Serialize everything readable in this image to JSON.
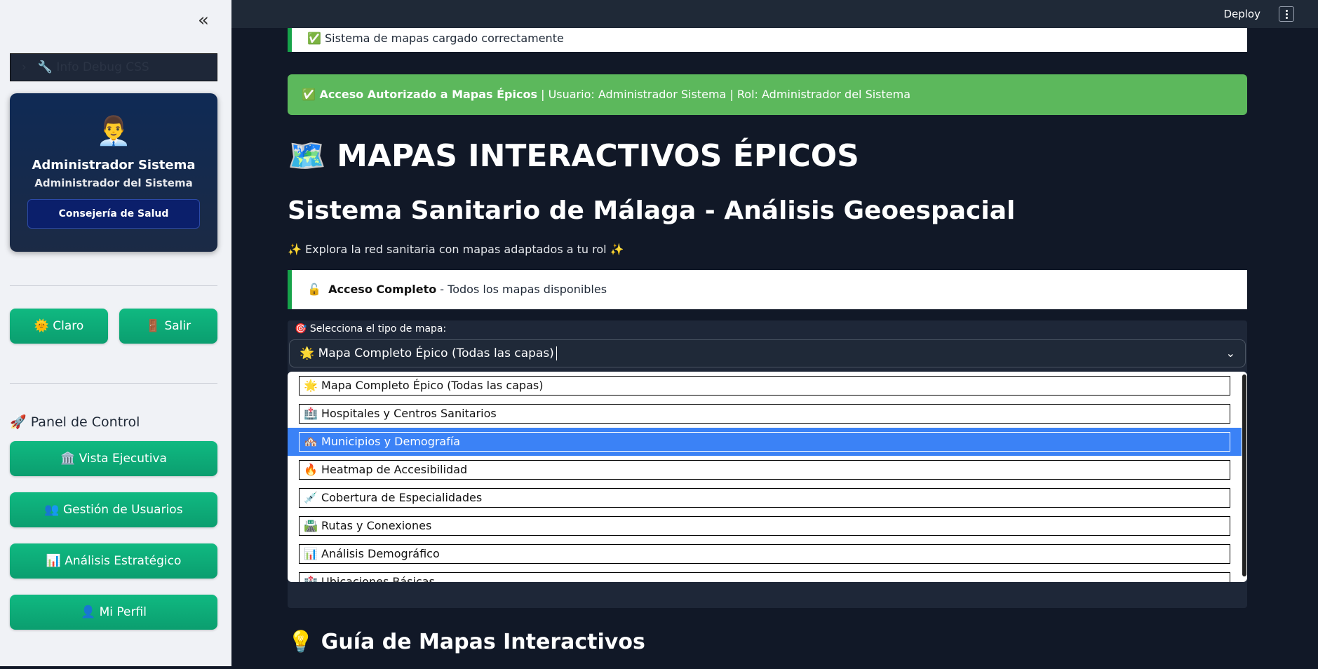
{
  "sidebar": {
    "collapse_icon": "«",
    "debug_label": "🔧 Info Debug CSS",
    "debug_chevron": "›",
    "profile": {
      "avatar": "👨‍💼",
      "name": "Administrador Sistema",
      "role": "Administrador del Sistema",
      "department": "Consejería de Salud"
    },
    "theme_button": "🌞 Claro",
    "logout_button": "🚪 Salir",
    "panel_title": "🚀 Panel de Control",
    "nav": [
      {
        "label": "🏛️ Vista Ejecutiva"
      },
      {
        "label": "👥 Gestión de Usuarios"
      },
      {
        "label": "📊 Análisis Estratégico"
      },
      {
        "label": "👤 Mi Perfil"
      }
    ]
  },
  "header": {
    "deploy": "Deploy",
    "menu_icon": "kebab-menu-icon"
  },
  "main": {
    "top_notice": "✅ Sistema de mapas cargado correctamente",
    "access_alert": {
      "bold": "✅ Acceso Autorizado a Mapas Épicos",
      "rest": " | Usuario: Administrador Sistema | Rol: Administrador del Sistema"
    },
    "title": "🗺️ MAPAS INTERACTIVOS ÉPICOS",
    "subtitle_title": "Sistema Sanitario de Málaga - Análisis Geoespacial",
    "tagline": "✨ Explora la red sanitaria con mapas adaptados a tu rol ✨",
    "access_box": {
      "icon": "🔓",
      "bold": "Acceso Completo",
      "rest": " - Todos los mapas disponibles"
    },
    "select": {
      "label": "🎯 Selecciona el tipo de mapa:",
      "value": "🌟 Mapa Completo Épico (Todas las capas)",
      "caret": "⌄",
      "options": [
        "🌟 Mapa Completo Épico (Todas las capas)",
        "🏥 Hospitales y Centros Sanitarios",
        "🏘️ Municipios y Demografía",
        "🔥 Heatmap de Accesibilidad",
        "💉 Cobertura de Especialidades",
        "🛣️ Rutas y Conexiones",
        "📊 Análisis Demográfico",
        "🏥 Ubicaciones Básicas"
      ],
      "highlighted_index": 2
    },
    "guide_title": "💡 Guía de Mapas Interactivos"
  },
  "colors": {
    "accent_green": "#10b981",
    "alert_green": "#5cb85c",
    "highlight_blue": "#3b82f6",
    "dark_bg": "#111827"
  }
}
